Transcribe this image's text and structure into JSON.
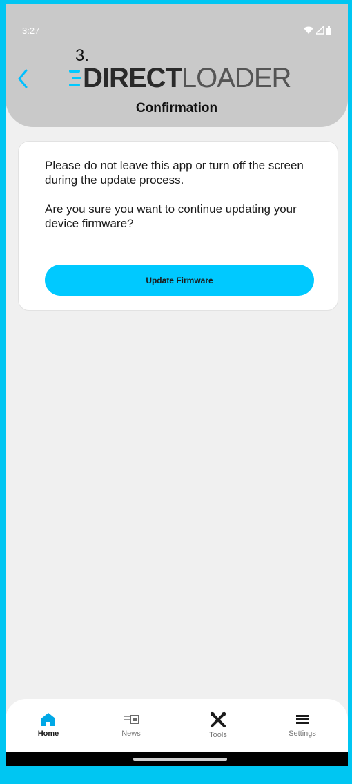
{
  "status_bar": {
    "time": "3:27"
  },
  "header": {
    "step_label": "3.",
    "logo_bold": "DIRECT",
    "logo_light": "LOADER",
    "title": "Confirmation"
  },
  "card": {
    "message_1": "Please do not leave this app or turn off the screen during the update process.",
    "message_2": "Are you sure you want to continue updating your device firmware?",
    "button_label": "Update Firmware"
  },
  "nav": {
    "items": [
      {
        "label": "Home",
        "icon": "home-icon",
        "active": true
      },
      {
        "label": "News",
        "icon": "news-icon",
        "active": false
      },
      {
        "label": "Tools",
        "icon": "tools-icon",
        "active": false
      },
      {
        "label": "Settings",
        "icon": "menu-icon",
        "active": false
      }
    ]
  },
  "colors": {
    "accent": "#00c9ff",
    "frame": "#00c6f2",
    "header_bg": "#c9c9c9",
    "page_bg": "#f0f0f0"
  }
}
